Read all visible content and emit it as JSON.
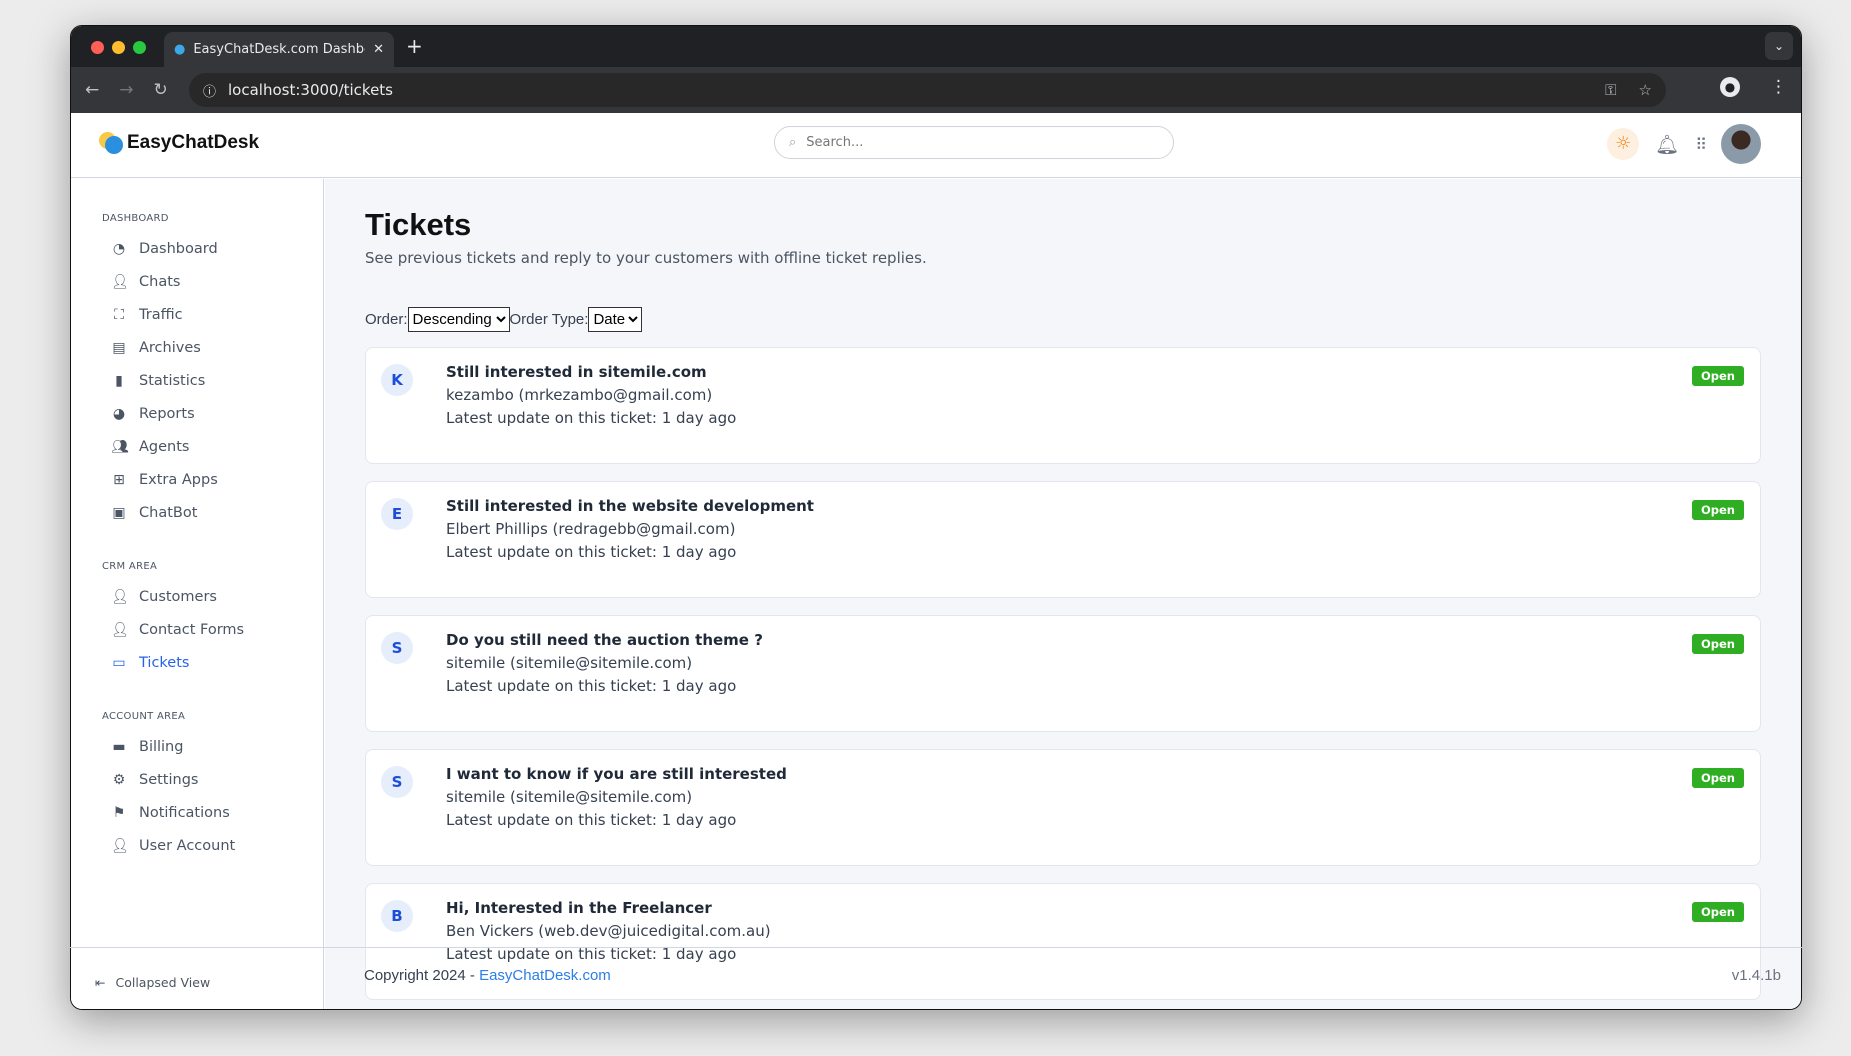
{
  "browser": {
    "tab_title": "EasyChatDesk.com Dashboard",
    "url": "localhost:3000/tickets"
  },
  "header": {
    "logo": "EasyChatDesk",
    "search_placeholder": "Search..."
  },
  "sidebar": {
    "sections": [
      {
        "title": "DASHBOARD",
        "items": [
          {
            "label": "Dashboard",
            "icon": "gauge-icon"
          },
          {
            "label": "Chats",
            "icon": "user-icon"
          },
          {
            "label": "Traffic",
            "icon": "users-viewfinder-icon"
          },
          {
            "label": "Archives",
            "icon": "archive-box-icon"
          },
          {
            "label": "Statistics",
            "icon": "bar-chart-icon"
          },
          {
            "label": "Reports",
            "icon": "pie-chart-icon"
          },
          {
            "label": "Agents",
            "icon": "users-icon"
          },
          {
            "label": "Extra Apps",
            "icon": "grid-icon"
          },
          {
            "label": "ChatBot",
            "icon": "robot-icon"
          }
        ]
      },
      {
        "title": "CRM AREA",
        "items": [
          {
            "label": "Customers",
            "icon": "user-plus-icon"
          },
          {
            "label": "Contact Forms",
            "icon": "user-plus-icon"
          },
          {
            "label": "Tickets",
            "icon": "ticket-icon",
            "active": true
          }
        ]
      },
      {
        "title": "ACCOUNT AREA",
        "items": [
          {
            "label": "Billing",
            "icon": "credit-card-icon"
          },
          {
            "label": "Settings",
            "icon": "gear-icon"
          },
          {
            "label": "Notifications",
            "icon": "flag-icon"
          },
          {
            "label": "User Account",
            "icon": "user-gear-icon"
          }
        ]
      }
    ],
    "collapse_label": "Collapsed View"
  },
  "main": {
    "title": "Tickets",
    "subtitle": "See previous tickets and reply to your customers with offline ticket replies.",
    "order_label": "Order:",
    "order_value": "Descending",
    "order_type_label": "Order Type:",
    "order_type_value": "Date",
    "tickets": [
      {
        "initial": "K",
        "title": "Still interested in sitemile.com",
        "from": "kezambo (mrkezambo@gmail.com)",
        "updated": "Latest update on this ticket: 1 day ago",
        "status": "Open"
      },
      {
        "initial": "E",
        "title": "Still interested in the website development",
        "from": "Elbert Phillips (redragebb@gmail.com)",
        "updated": "Latest update on this ticket: 1 day ago",
        "status": "Open"
      },
      {
        "initial": "S",
        "title": "Do you still need the auction theme ?",
        "from": "sitemile (sitemile@sitemile.com)",
        "updated": "Latest update on this ticket: 1 day ago",
        "status": "Open"
      },
      {
        "initial": "S",
        "title": "I want to know if you are still interested",
        "from": "sitemile (sitemile@sitemile.com)",
        "updated": "Latest update on this ticket: 1 day ago",
        "status": "Open"
      },
      {
        "initial": "B",
        "title": "Hi, Interested in the Freelancer",
        "from": "Ben Vickers (web.dev@juicedigital.com.au)",
        "updated": "Latest update on this ticket: 1 day ago",
        "status": "Open"
      }
    ]
  },
  "footer": {
    "copyright": "Copyright 2024 - ",
    "link": "EasyChatDesk.com",
    "version": "v1.4.1b"
  },
  "colors": {
    "accent": "#2563eb",
    "open_badge": "#2fae24"
  }
}
